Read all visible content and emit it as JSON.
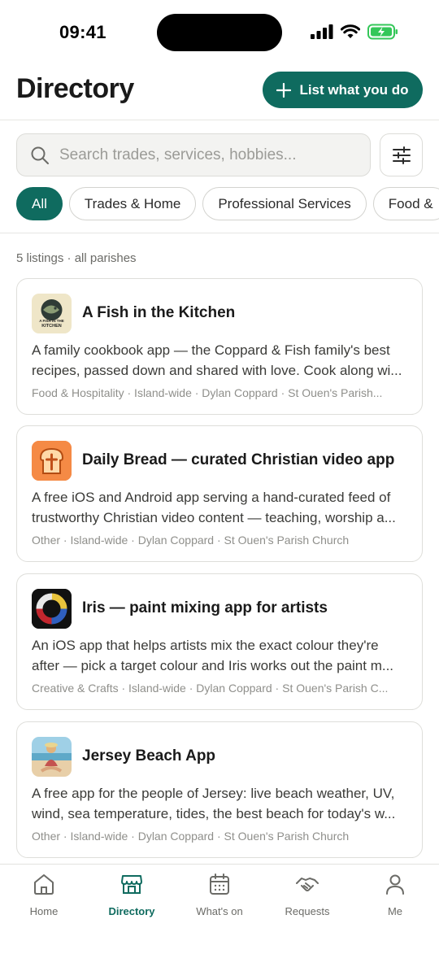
{
  "status": {
    "time": "09:41"
  },
  "header": {
    "title": "Directory",
    "cta_label": "List what you do"
  },
  "search": {
    "placeholder": "Search trades, services, hobbies..."
  },
  "chips": [
    "All",
    "Trades & Home",
    "Professional Services",
    "Food &"
  ],
  "listing_count": "5 listings · all parishes",
  "listings": [
    {
      "title": "A Fish in the Kitchen",
      "icon": "fish-kitchen-logo-icon",
      "icon_text_1": "A FISH IN THE",
      "icon_text_2": "KITCHEN",
      "desc_line1": "A family cookbook app — the Coppard & Fish family's best",
      "desc_line2": "recipes, passed down and shared with love. Cook along wi...",
      "meta": "Food & Hospitality · Island-wide · Dylan Coppard · St Ouen's Parish..."
    },
    {
      "title": "Daily Bread — curated Christian video app",
      "icon": "bread-icon",
      "desc_line1": "A free iOS and Android app serving a hand-curated feed of",
      "desc_line2": "trustworthy Christian video content — teaching, worship a...",
      "meta": "Other · Island-wide · Dylan Coppard · St Ouen's Parish Church"
    },
    {
      "title": "Iris — paint mixing app for artists",
      "icon": "color-wheel-icon",
      "desc_line1": "An iOS app that helps artists mix the exact colour they're",
      "desc_line2": "after — pick a target colour and Iris works out the paint m...",
      "meta": "Creative & Crafts · Island-wide · Dylan Coppard · St Ouen's Parish C..."
    },
    {
      "title": "Jersey Beach App",
      "icon": "beach-photo-icon",
      "desc_line1": "A free app for the people of Jersey: live beach weather, UV,",
      "desc_line2": "wind, sea temperature, tides, the best beach for today's w...",
      "meta": "Other · Island-wide · Dylan Coppard · St Ouen's Parish Church"
    }
  ],
  "nav": [
    {
      "label": "Home",
      "icon": "home-icon",
      "active": false
    },
    {
      "label": "Directory",
      "icon": "storefront-icon",
      "active": true
    },
    {
      "label": "What's on",
      "icon": "calendar-icon",
      "active": false
    },
    {
      "label": "Requests",
      "icon": "handshake-icon",
      "active": false
    },
    {
      "label": "Me",
      "icon": "person-icon",
      "active": false
    }
  ],
  "colors": {
    "accent": "#0f6b5f",
    "battery": "#34c759"
  }
}
